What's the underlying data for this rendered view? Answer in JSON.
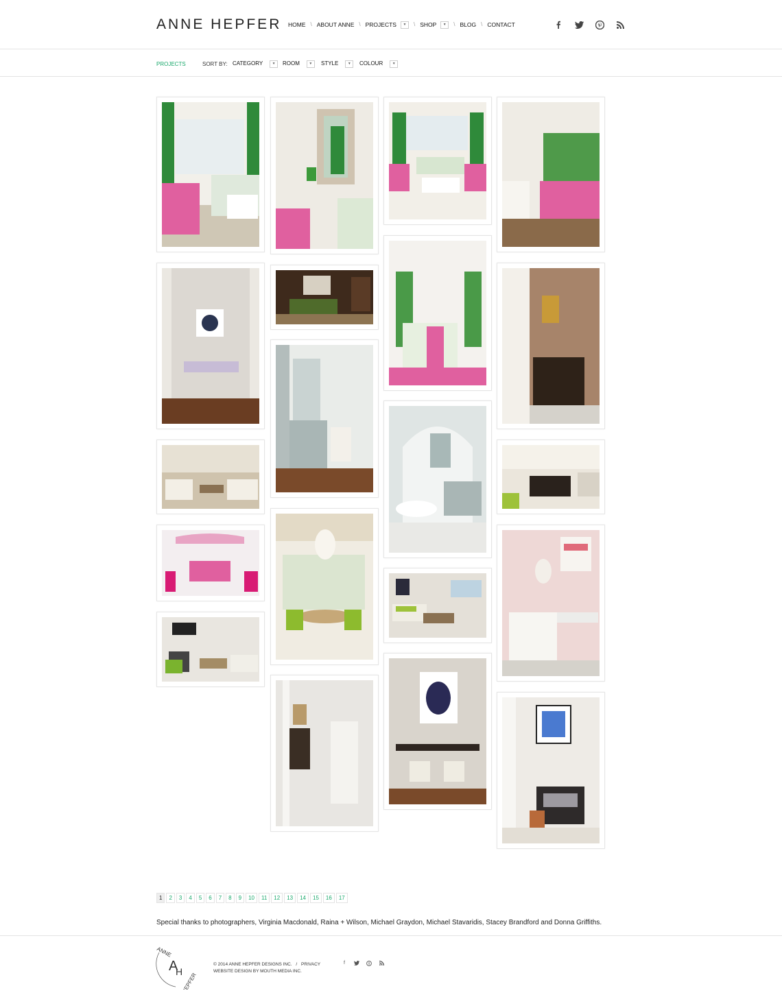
{
  "header": {
    "logo": "ANNE HEPFER",
    "nav": [
      {
        "label": "HOME",
        "dropdown": false
      },
      {
        "label": "ABOUT ANNE",
        "dropdown": false
      },
      {
        "label": "PROJECTS",
        "dropdown": true
      },
      {
        "label": "SHOP",
        "dropdown": true
      },
      {
        "label": "BLOG",
        "dropdown": false
      },
      {
        "label": "CONTACT",
        "dropdown": false
      }
    ],
    "nav_separator": "\\",
    "dropdown_arrow": "▼",
    "social": [
      "facebook-icon",
      "twitter-icon",
      "pinterest-icon",
      "rss-icon"
    ]
  },
  "sortbar": {
    "crumb": "PROJECTS",
    "sort_label": "SORT BY:",
    "filters": [
      "CATEGORY",
      "ROOM",
      "STYLE",
      "COLOUR"
    ]
  },
  "pagination": {
    "current": "1",
    "pages": [
      "1",
      "2",
      "3",
      "4",
      "5",
      "6",
      "7",
      "8",
      "9",
      "10",
      "11",
      "12",
      "13",
      "14",
      "15",
      "16",
      "17"
    ]
  },
  "thanks": "Special thanks to photographers, Virginia Macdonald, Raina + Wilson, Michael Graydon, Michael Stavaridis, Stacey Brandford and Donna Griffiths.",
  "footer": {
    "logo_top": "ANNE",
    "logo_a": "A",
    "logo_h": "H",
    "logo_bottom": "HEPFER",
    "copyright": "© 2014 ANNE HEPFER DESIGNS INC.",
    "sep": "/",
    "privacy": "PRIVACY",
    "credit": "WEBSITE DESIGN BY MOUTH MEDIA INC."
  },
  "colors": {
    "accent_green": "#19a86b",
    "pink": "#e0609f",
    "leaf_green": "#2f8a3a"
  }
}
